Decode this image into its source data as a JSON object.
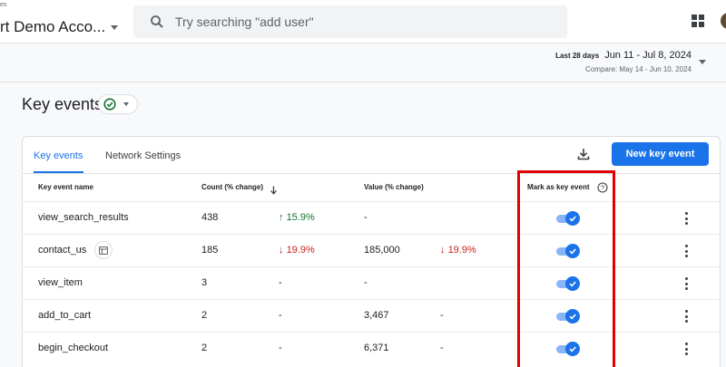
{
  "header": {
    "breadcrumb": "es",
    "account_name": "rt Demo Acco...",
    "search_placeholder": "Try searching \"add user\""
  },
  "date_range": {
    "label": "Last 28 days",
    "range": "Jun 11 - Jul 8, 2024",
    "compare": "Compare: May 14 - Jun 10, 2024"
  },
  "page": {
    "title": "Key events"
  },
  "tabs": [
    {
      "label": "Key events",
      "active": true
    },
    {
      "label": "Network Settings",
      "active": false
    }
  ],
  "actions": {
    "new_key_event": "New key event"
  },
  "table": {
    "headers": {
      "name": "Key event name",
      "count": "Count (% change)",
      "value": "Value (% change)",
      "mark": "Mark as key event"
    },
    "rows": [
      {
        "name": "view_search_results",
        "count": "438",
        "count_change": "15.9%",
        "count_dir": "up",
        "value": "-",
        "value_change": "",
        "value_dir": "",
        "marked": true
      },
      {
        "name": "contact_us",
        "count": "185",
        "count_change": "19.9%",
        "count_dir": "down",
        "value": "185,000",
        "value_change": "19.9%",
        "value_dir": "down",
        "marked": true
      },
      {
        "name": "view_item",
        "count": "3",
        "count_change": "-",
        "count_dir": "",
        "value": "-",
        "value_change": "",
        "value_dir": "",
        "marked": true
      },
      {
        "name": "add_to_cart",
        "count": "2",
        "count_change": "-",
        "count_dir": "",
        "value": "3,467",
        "value_change": "-",
        "value_dir": "",
        "marked": true
      },
      {
        "name": "begin_checkout",
        "count": "2",
        "count_change": "-",
        "count_dir": "",
        "value": "6,371",
        "value_change": "-",
        "value_dir": "",
        "marked": true
      }
    ]
  },
  "colors": {
    "accent": "#1a73e8",
    "positive": "#137333",
    "negative": "#c5221f",
    "highlight": "#e00000"
  }
}
